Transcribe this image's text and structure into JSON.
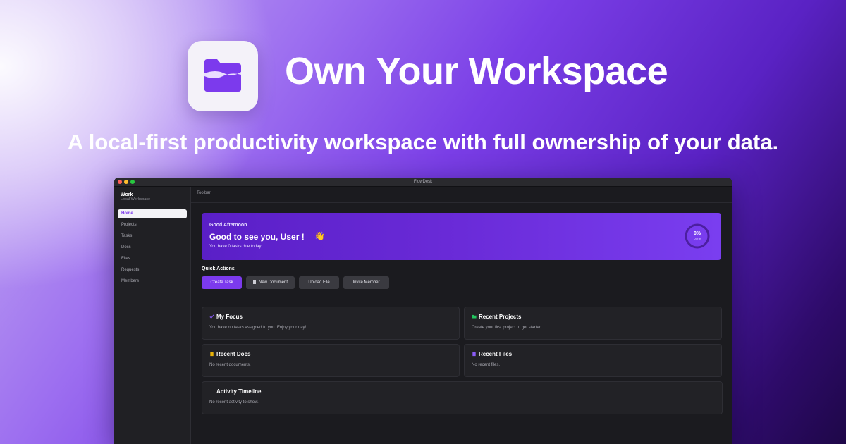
{
  "hero": {
    "title": "Own Your Workspace",
    "tagline": "A local-first productivity workspace with full ownership of your data.",
    "logo_icon": "folder-icon"
  },
  "window": {
    "title": "FlowDesk"
  },
  "sidebar": {
    "workspace_name": "Work",
    "workspace_sub": "Local Workspace",
    "items": [
      {
        "label": "Home",
        "active": true
      },
      {
        "label": "Projects"
      },
      {
        "label": "Tasks"
      },
      {
        "label": "Docs"
      },
      {
        "label": "Files"
      },
      {
        "label": "Requests"
      },
      {
        "label": "Members"
      }
    ]
  },
  "toolbar": {
    "label": "Toolbar"
  },
  "greeting": {
    "time_of_day": "Good Afternoon",
    "headline": "Good to see you,  User !",
    "wave_emoji": "👋",
    "subtext": "You have 0 tasks due today.",
    "progress_value": "0%",
    "progress_fraction": 0,
    "progress_caption": "Done"
  },
  "quick_actions": {
    "title": "Quick Actions",
    "buttons": [
      "Create Task",
      "New Document",
      "Upload File",
      "Invite Member"
    ]
  },
  "cards": {
    "focus": {
      "title": "My Focus",
      "body": "You have no tasks assigned to you. Enjoy your day!",
      "icon": "check-icon"
    },
    "projects": {
      "title": "Recent Projects",
      "body": "Create your first project to get started.",
      "icon": "folder-icon"
    },
    "docs": {
      "title": "Recent Docs",
      "body": "No recent documents.",
      "icon": "document-icon"
    },
    "files": {
      "title": "Recent Files",
      "body": "No recent files.",
      "icon": "file-icon"
    },
    "activity": {
      "title": "Activity Timeline",
      "body": "No recent activity to show."
    }
  },
  "colors": {
    "accent": "#7c3aed",
    "background_dark": "#1b1b1f",
    "projects_icon": "#22c55e",
    "docs_icon": "#eab308",
    "files_icon": "#8b5cf6"
  }
}
